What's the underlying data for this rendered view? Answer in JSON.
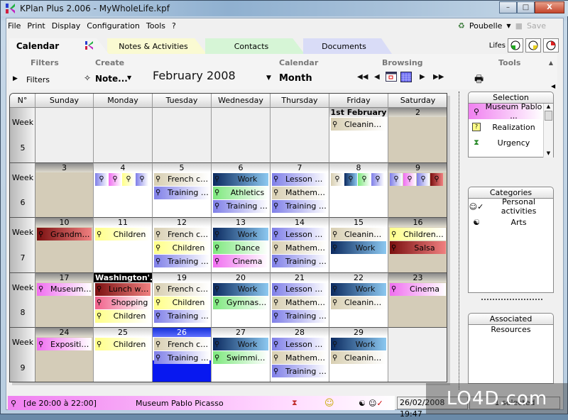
{
  "window": {
    "title": "KPlan Plus 2.006 - MyWholeLife.kpf",
    "min": "–",
    "max": "□",
    "close": "X"
  },
  "menu": [
    {
      "label": "File"
    },
    {
      "label": "Print"
    },
    {
      "label": "Display"
    },
    {
      "label": "Configuration"
    },
    {
      "label": "Tools"
    },
    {
      "label": "?"
    }
  ],
  "top_tools": {
    "trash_label": "Poubelle",
    "save_label": "Save"
  },
  "tabs": [
    {
      "label": "Calendar",
      "active": true
    },
    {
      "label": "Notes & Activities"
    },
    {
      "label": "Contacts"
    },
    {
      "label": "Documents"
    }
  ],
  "lifes": {
    "label": "Lifes",
    "colors": [
      "#22aa22",
      "#e8d020",
      "#dd2222"
    ]
  },
  "toolbar": {
    "groups": {
      "filters": "Filters",
      "create": "Create",
      "calendar": "Calendar",
      "browsing": "Browsing",
      "tools": "Tools"
    },
    "filters_toggle": "Filters",
    "create_button": "Note...",
    "month_title": "February 2008",
    "view_select": "Month"
  },
  "calendar": {
    "headers": [
      "N°",
      "Sunday",
      "Monday",
      "Tuesday",
      "Wednesday",
      "Thursday",
      "Friday",
      "Saturday"
    ],
    "week_label": "Week",
    "weeks": [
      {
        "number": "5",
        "days": [
          {
            "empty": true
          },
          {
            "empty": true
          },
          {
            "empty": true
          },
          {
            "empty": true
          },
          {
            "empty": true
          },
          {
            "label": "1st February",
            "style": "first",
            "events": [
              {
                "text": "Cleaning lady",
                "color": "tan"
              }
            ]
          },
          {
            "label": "2",
            "weekend": true,
            "events": []
          }
        ]
      },
      {
        "number": "6",
        "days": [
          {
            "label": "3",
            "weekend": true,
            "events": []
          },
          {
            "label": "4",
            "icons": [
              "lav",
              "pnk",
              "ylw",
              "lav"
            ]
          },
          {
            "label": "5",
            "events": [
              {
                "text": "French cou...",
                "color": "tan"
              },
              {
                "text": "Training of ...",
                "color": "lav"
              }
            ]
          },
          {
            "label": "6",
            "events": [
              {
                "text": "Work",
                "color": "navy"
              },
              {
                "text": "Athletics",
                "color": "grn"
              },
              {
                "text": "Training of ...",
                "color": "lav"
              }
            ]
          },
          {
            "label": "7",
            "events": [
              {
                "text": "Lesson of ...",
                "color": "lav"
              },
              {
                "text": "Mathematics",
                "color": "tan"
              },
              {
                "text": "Training of ...",
                "color": "lav"
              }
            ]
          },
          {
            "label": "8",
            "icons": [
              "tan",
              "navy",
              "grn",
              "lav"
            ]
          },
          {
            "label": "9",
            "weekend": true,
            "icons": [
              "lav",
              "pnk",
              "lav",
              "red"
            ]
          }
        ]
      },
      {
        "number": "7",
        "days": [
          {
            "label": "10",
            "weekend": true,
            "events": [
              {
                "text": "Grandma's ...",
                "color": "red"
              }
            ]
          },
          {
            "label": "11",
            "events": [
              {
                "text": "Children",
                "color": "ylw"
              }
            ]
          },
          {
            "label": "12",
            "events": [
              {
                "text": "French cou...",
                "color": "tan"
              },
              {
                "text": "Children",
                "color": "ylw"
              },
              {
                "text": "Training of ...",
                "color": "lav"
              }
            ]
          },
          {
            "label": "13",
            "events": [
              {
                "text": "Work",
                "color": "navy"
              },
              {
                "text": "Dance",
                "color": "grn"
              },
              {
                "text": "Cinema",
                "color": "pnk"
              }
            ]
          },
          {
            "label": "14",
            "events": [
              {
                "text": "Lesson of ...",
                "color": "lav"
              },
              {
                "text": "Mathematics",
                "color": "tan"
              },
              {
                "text": "Training of ...",
                "color": "lav"
              }
            ]
          },
          {
            "label": "15",
            "events": [
              {
                "text": "Cleaning lady",
                "color": "tan"
              },
              {
                "text": "Work",
                "color": "navy"
              }
            ]
          },
          {
            "label": "16",
            "weekend": true,
            "events": [
              {
                "text": "Children pa...",
                "color": "ylw"
              },
              {
                "text": "Salsa",
                "color": "red"
              }
            ]
          }
        ]
      },
      {
        "number": "8",
        "days": [
          {
            "label": "17",
            "weekend": true,
            "events": [
              {
                "text": "Museum P...",
                "color": "pnk"
              }
            ]
          },
          {
            "label": "Washington'...",
            "style": "hol",
            "events": [
              {
                "text": "Lunch with...",
                "color": "red"
              },
              {
                "text": "Shopping",
                "color": "rose"
              },
              {
                "text": "Children",
                "color": "ylw"
              }
            ]
          },
          {
            "label": "19",
            "events": [
              {
                "text": "French cou...",
                "color": "tan"
              },
              {
                "text": "Children",
                "color": "ylw"
              },
              {
                "text": "Training of ...",
                "color": "lav"
              }
            ]
          },
          {
            "label": "20",
            "events": [
              {
                "text": "Work",
                "color": "navy"
              },
              {
                "text": "Gymnastics",
                "color": "grn"
              }
            ]
          },
          {
            "label": "21",
            "events": [
              {
                "text": "Lesson of ...",
                "color": "lav"
              },
              {
                "text": "Mathematics",
                "color": "tan"
              },
              {
                "text": "Training of ...",
                "color": "lav"
              }
            ]
          },
          {
            "label": "22",
            "events": [
              {
                "text": "Work",
                "color": "navy"
              },
              {
                "text": "Cleaning lady",
                "color": "tan"
              }
            ]
          },
          {
            "label": "23",
            "weekend": true,
            "events": [
              {
                "text": "Cinema",
                "color": "pnk"
              }
            ]
          }
        ]
      },
      {
        "number": "9",
        "days": [
          {
            "label": "24",
            "weekend": true,
            "events": [
              {
                "text": "Exposition r...",
                "color": "pnk"
              }
            ]
          },
          {
            "label": "25",
            "events": [
              {
                "text": "Children",
                "color": "ylw"
              }
            ]
          },
          {
            "label": "26",
            "style": "today",
            "events": [
              {
                "text": "French cou...",
                "color": "tan"
              },
              {
                "text": "Training of ...",
                "color": "lav"
              }
            ]
          },
          {
            "label": "27",
            "events": [
              {
                "text": "Work",
                "color": "navy"
              },
              {
                "text": "Swimming ...",
                "color": "grn"
              }
            ]
          },
          {
            "label": "28",
            "events": [
              {
                "text": "Lesson of ...",
                "color": "lav"
              },
              {
                "text": "Mathematics",
                "color": "tan"
              },
              {
                "text": "Training of ...",
                "color": "lav"
              }
            ]
          },
          {
            "label": "29",
            "events": [
              {
                "text": "Work",
                "color": "navy"
              },
              {
                "text": "Cleaning lady",
                "color": "tan"
              }
            ]
          },
          {
            "empty": true
          }
        ]
      }
    ]
  },
  "side": {
    "selection": {
      "title": "Selection",
      "items": [
        {
          "icon": "pin-icon",
          "text": "Museum Pablo ..."
        },
        {
          "icon": "note-icon",
          "text": "Realization"
        },
        {
          "icon": "hourglass-icon",
          "text": "Urgency"
        }
      ]
    },
    "categories": {
      "title": "Categories",
      "items": [
        {
          "icon": "person-check-icon",
          "text": "Personal activities"
        },
        {
          "icon": "yinyang-icon",
          "text": "Arts"
        }
      ]
    },
    "resources": {
      "title": "Associated Resources"
    }
  },
  "status": {
    "time": "[de 20:00 à 22:00]",
    "title": "Museum Pablo Picasso",
    "datetime": "26/02/2008 19:47",
    "selection": "1 selected"
  },
  "watermark": "LO4D.com"
}
